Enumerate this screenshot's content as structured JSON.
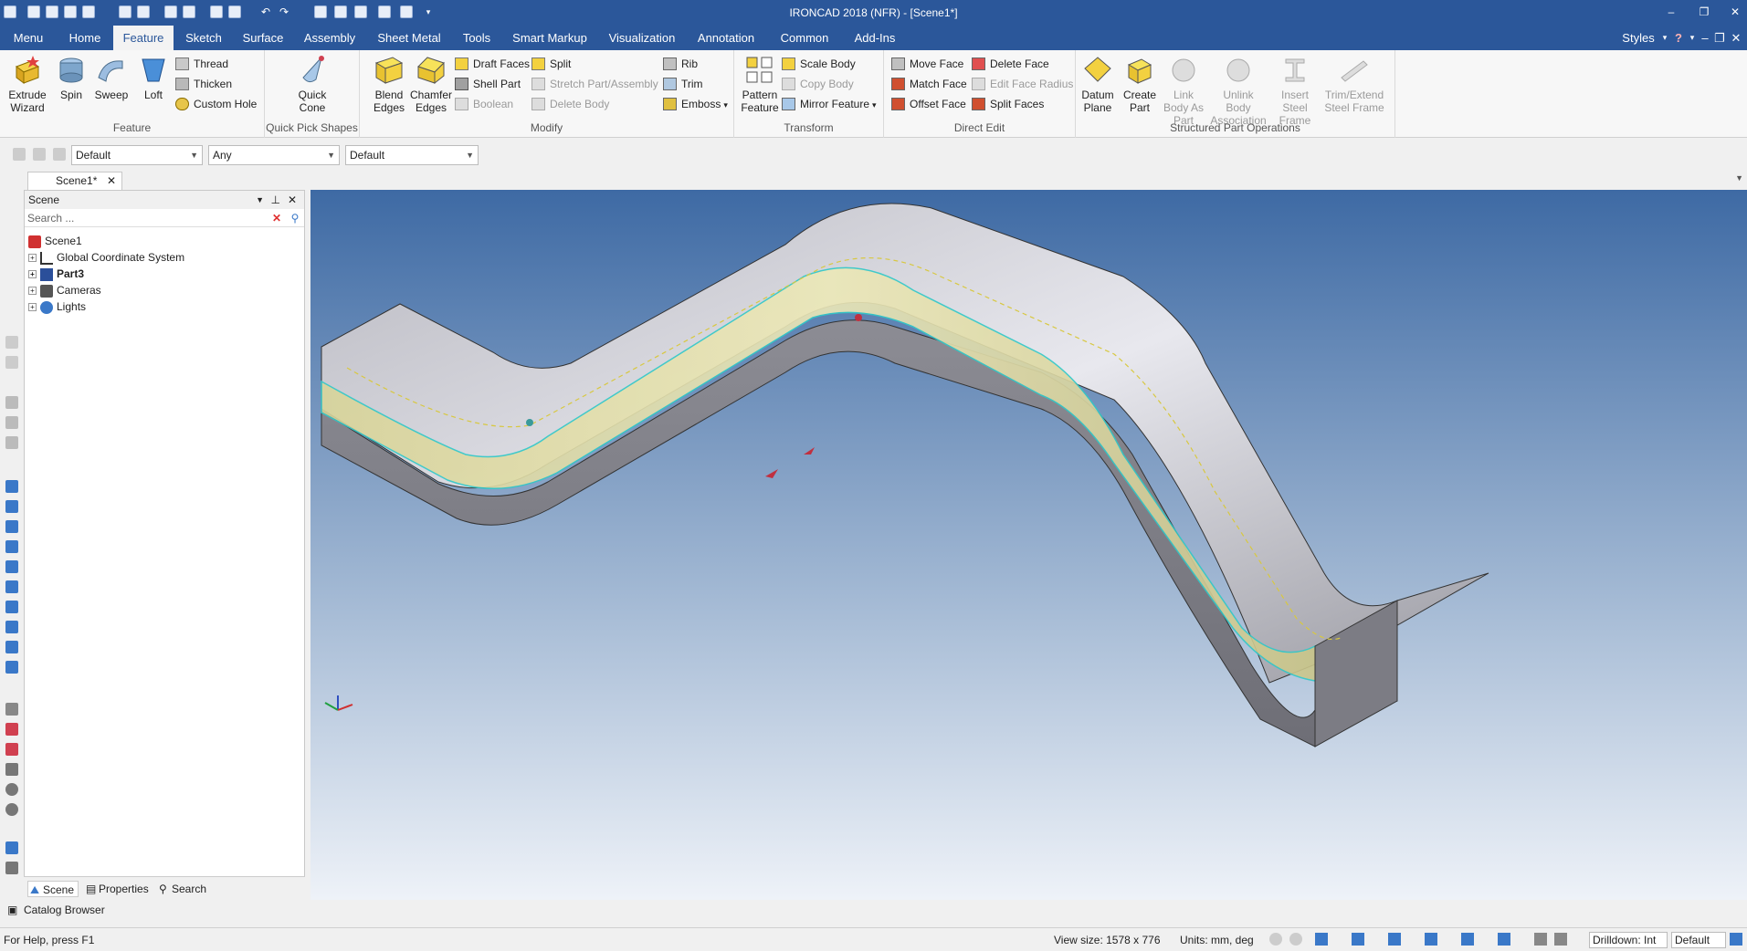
{
  "window": {
    "title": "IRONCAD 2018 (NFR) - [Scene1*]"
  },
  "menu_tabs": [
    "Menu",
    "Home",
    "Feature",
    "Sketch",
    "Surface",
    "Assembly",
    "Sheet Metal",
    "Tools",
    "Smart Markup",
    "Visualization",
    "Annotation",
    "Common",
    "Add-Ins"
  ],
  "styles_label": "Styles",
  "ribbon": {
    "feature": {
      "label": "Feature",
      "extrude": "Extrude Wizard",
      "spin": "Spin",
      "sweep": "Sweep",
      "loft": "Loft",
      "thread": "Thread",
      "thicken": "Thicken",
      "custom_hole": "Custom Hole"
    },
    "quick_pick": {
      "label": "Quick Pick Shapes",
      "quick_cone": "Quick Cone"
    },
    "modify": {
      "label": "Modify",
      "blend": "Blend Edges",
      "chamfer": "Chamfer Edges",
      "draft": "Draft Faces",
      "shell": "Shell Part",
      "boolean": "Boolean",
      "split": "Split",
      "stretch": "Stretch Part/Assembly",
      "delete_body": "Delete Body",
      "rib": "Rib",
      "trim": "Trim",
      "emboss": "Emboss"
    },
    "transform": {
      "label": "Transform",
      "pattern": "Pattern Feature",
      "scale": "Scale Body",
      "copy": "Copy Body",
      "mirror": "Mirror Feature"
    },
    "direct_edit": {
      "label": "Direct Edit",
      "move": "Move Face",
      "match": "Match Face",
      "offset": "Offset Face",
      "delete": "Delete Face",
      "edit_radius": "Edit Face Radius",
      "split_faces": "Split Faces"
    },
    "structured": {
      "label": "Structured Part Operations",
      "datum": "Datum Plane",
      "create_part": "Create Part",
      "link_body": "Link Body As Part",
      "unlink_body": "Unlink Body Association",
      "insert_steel": "Insert Steel Frame",
      "trim_steel": "Trim/Extend Steel Frame"
    }
  },
  "filters": [
    "Default",
    "Any",
    "Default"
  ],
  "doc_tab": "Scene1*",
  "scene_panel": {
    "title": "Scene",
    "search_placeholder": "Search ...",
    "tree": [
      "Scene1",
      "Global Coordinate System",
      "Part3",
      "Cameras",
      "Lights"
    ],
    "tabs": [
      "Scene",
      "Properties",
      "Search"
    ]
  },
  "catalog_browser": "Catalog Browser",
  "status": {
    "help": "For Help, press F1",
    "view_size": "View size: 1578 x 776",
    "units": "Units: mm, deg",
    "drilldown": "Drilldown: Int",
    "default": "Default"
  },
  "colors": {
    "title_bar": "#2b579a",
    "part_face": "#8c8c94",
    "highlight": "#e4e0a8",
    "accent": "#30c8c8"
  }
}
